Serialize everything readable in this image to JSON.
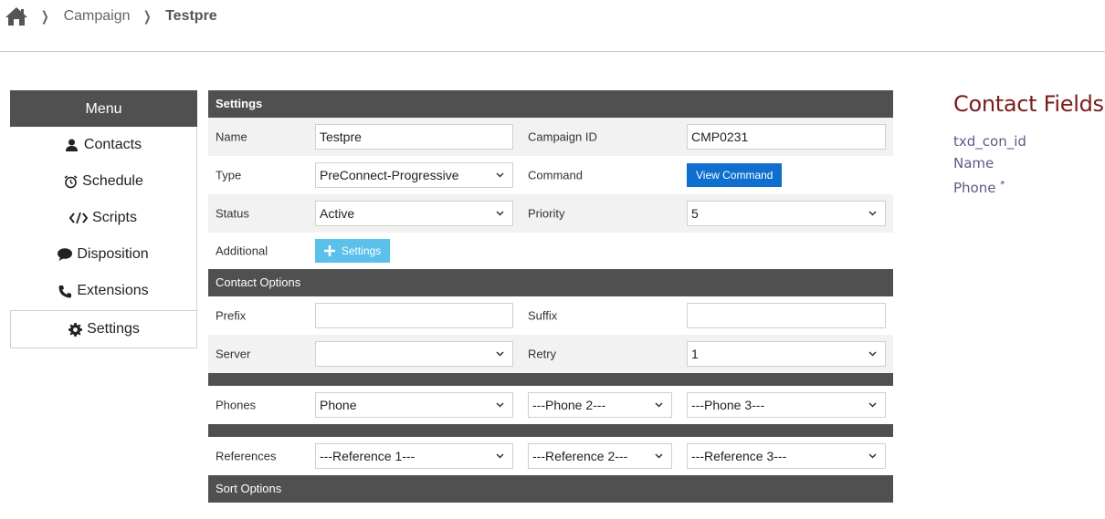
{
  "breadcrumb": {
    "items": [
      "Campaign",
      "Testpre"
    ]
  },
  "menu": {
    "title": "Menu",
    "items": [
      {
        "label": "Contacts",
        "icon": "user-icon"
      },
      {
        "label": "Schedule",
        "icon": "alarm-clock-icon"
      },
      {
        "label": "Scripts",
        "icon": "code-icon"
      },
      {
        "label": "Disposition",
        "icon": "comment-icon"
      },
      {
        "label": "Extensions",
        "icon": "phone-icon"
      },
      {
        "label": "Settings",
        "icon": "gear-icon",
        "active": true
      }
    ]
  },
  "settings": {
    "section_title": "Settings",
    "name_label": "Name",
    "name_value": "Testpre",
    "campaign_id_label": "Campaign ID",
    "campaign_id_value": "CMP0231",
    "type_label": "Type",
    "type_value": "PreConnect-Progressive",
    "command_label": "Command",
    "view_command_label": "View Command",
    "status_label": "Status",
    "status_value": "Active",
    "priority_label": "Priority",
    "priority_value": "5",
    "additional_label": "Additional",
    "additional_settings_label": "Settings"
  },
  "contact_options": {
    "section_title": "Contact Options",
    "prefix_label": "Prefix",
    "prefix_value": "",
    "suffix_label": "Suffix",
    "suffix_value": "",
    "server_label": "Server",
    "server_value": "",
    "retry_label": "Retry",
    "retry_value": "1",
    "phones_label": "Phones",
    "phone1_value": "Phone",
    "phone2_value": "---Phone 2---",
    "phone3_value": "---Phone 3---",
    "references_label": "References",
    "reference1_value": "---Reference 1---",
    "reference2_value": "---Reference 2---",
    "reference3_value": "---Reference 3---"
  },
  "sort_options": {
    "section_title": "Sort Options"
  },
  "contact_fields": {
    "title": "Contact Fields",
    "items": [
      "txd_con_id",
      "Name",
      "Phone"
    ],
    "required_marker": "*"
  },
  "colors": {
    "section_bg": "#505050",
    "primary_button": "#0f6fce",
    "info_button": "#5bc0ea",
    "contact_fields_title": "#7b1c1c",
    "contact_field_item": "#5b5b86"
  }
}
